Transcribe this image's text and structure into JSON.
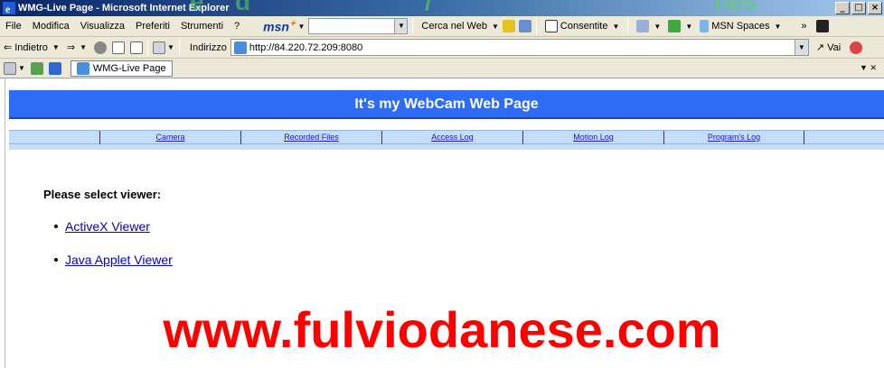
{
  "window": {
    "title": "WMG-Live Page - Microsoft Internet Explorer",
    "controls": [
      "_",
      "□",
      "×"
    ]
  },
  "menubar": {
    "items": [
      "File",
      "Modifica",
      "Visualizza",
      "Preferiti",
      "Strumenti",
      "?"
    ],
    "msn_logo": "msn",
    "search_label": "Cerca nel Web",
    "popup_label": "Consentite",
    "spaces_label": "MSN Spaces",
    "overflow": "»"
  },
  "navbar": {
    "back_label": "Indietro",
    "address_label": "Indirizzo",
    "address_value": "http://84.220.72.209:8080",
    "go_label": "Vai"
  },
  "tabbar": {
    "tab_label": "WMG-Live Page"
  },
  "page": {
    "banner_title": "It's my WebCam Web Page",
    "nav_links": [
      "Camera",
      "Recorded Files",
      "Access Log",
      "Motion Log",
      "Program's Log"
    ],
    "heading": "Please select viewer:",
    "viewers": [
      "ActiveX Viewer",
      "Java Applet Viewer"
    ]
  },
  "overlay": {
    "watermark": "www.fulviodanese.com"
  },
  "colors": {
    "banner_bg": "#2f6cf5",
    "nav_bg": "#c4def7",
    "link": "#0000cc",
    "watermark": "#ff0000"
  }
}
